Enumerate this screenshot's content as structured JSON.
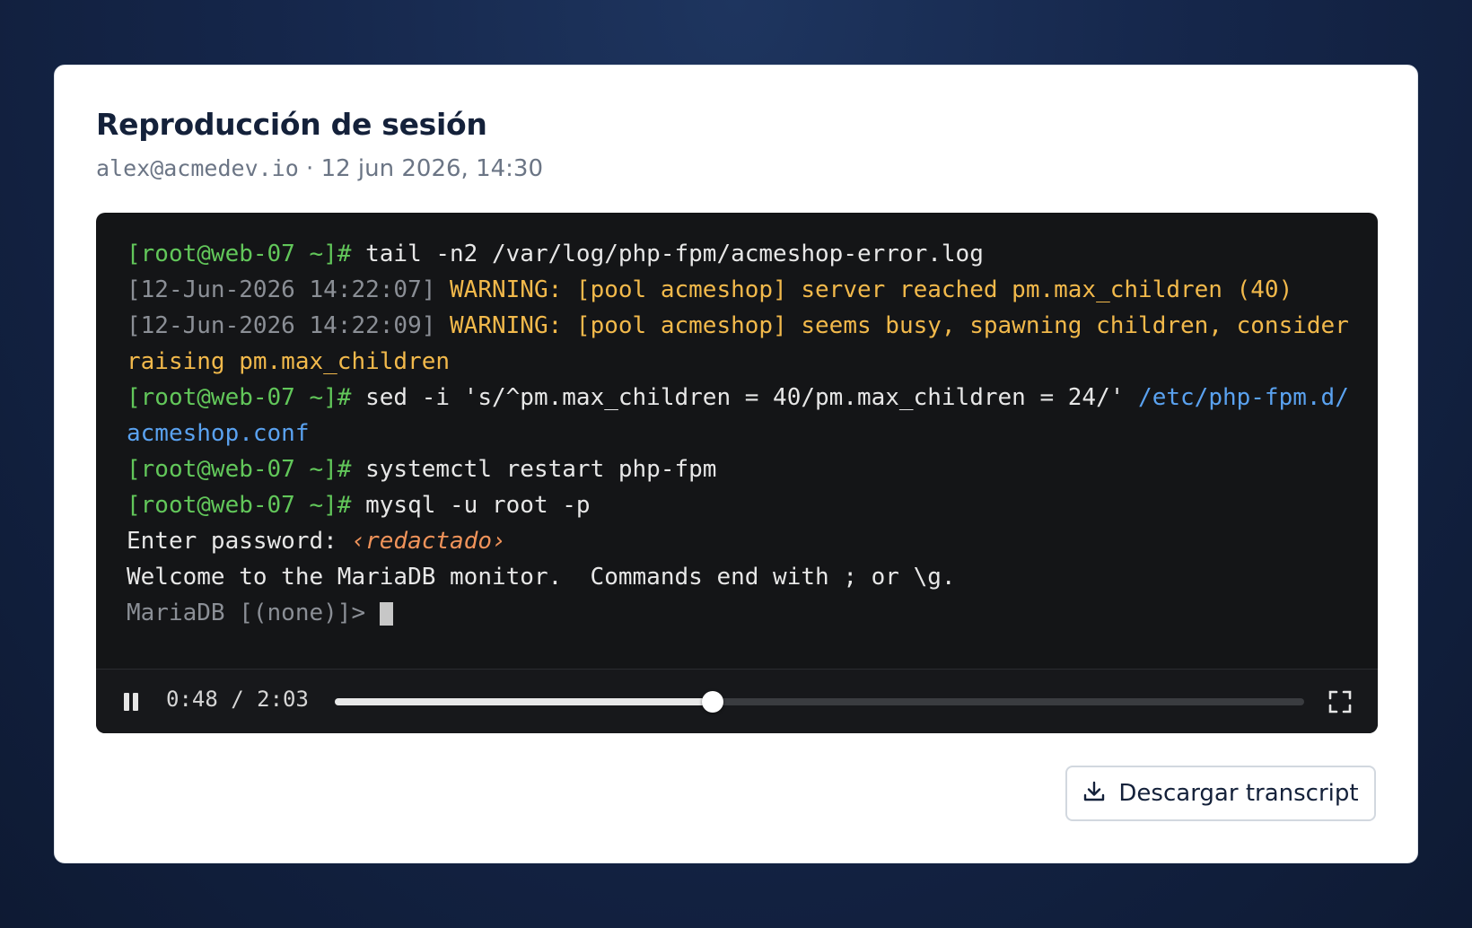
{
  "header": {
    "title": "Reproducción de sesión",
    "user": "alex@acmedev.io",
    "separator": " · ",
    "datetime": "12 jun 2026, 14:30"
  },
  "terminal": {
    "prompt": "[root@web-07 ~]#",
    "cmd1": "tail -n2 /var/log/php-fpm/acmeshop-error.log",
    "log1_ts": "[12-Jun-2026 14:22:07]",
    "log1_msg": "WARNING: [pool acmeshop] server reached pm.max_children (40)",
    "log2_ts": "[12-Jun-2026 14:22:09]",
    "log2_msg": "WARNING: [pool acmeshop] seems busy, spawning children, consider raising pm.max_children",
    "cmd2": "sed -i 's/^pm.max_children = 40/pm.max_children = 24/'",
    "cmd2_path": "/etc/php-fpm.d/acmeshop.conf",
    "cmd3": "systemctl restart php-fpm",
    "cmd4": "mysql -u root -p",
    "password_label": "Enter password:",
    "password_value": "‹redactado›",
    "welcome": "Welcome to the MariaDB monitor.  Commands end with ; or \\g.",
    "maria_prompt": "MariaDB [(none)]>"
  },
  "player": {
    "current_time": "0:48",
    "total_time": "2:03",
    "time_separator": " / ",
    "progress": 0.39,
    "pause_icon": "pause-icon",
    "fullscreen_icon": "fullscreen-icon"
  },
  "actions": {
    "download_label": "Descargar transcript",
    "download_icon": "download-icon"
  },
  "colors": {
    "prompt": "#62c75a",
    "warning": "#f2b94b",
    "path": "#5aa2f0",
    "redacted": "#f0935a"
  }
}
